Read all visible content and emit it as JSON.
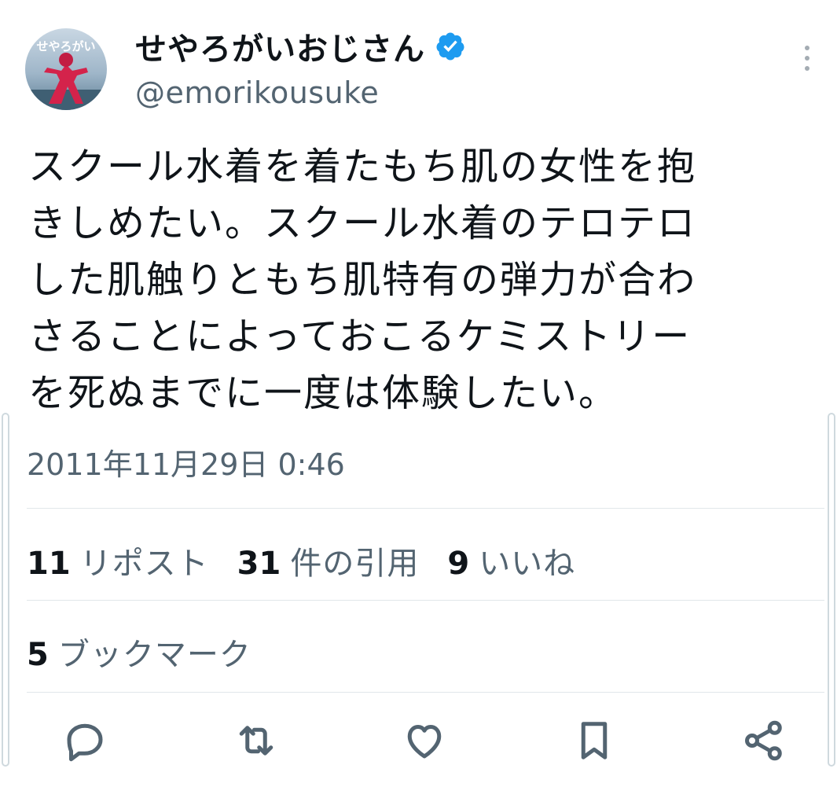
{
  "user": {
    "display_name": "せやろがいおじさん",
    "handle": "@emorikousuke",
    "avatar_caption": "せやろがい",
    "verified": true,
    "verified_color": "#1d9bf0"
  },
  "tweet": {
    "lines": [
      "スクール水着を着たもち肌の女性を抱",
      "きしめたい。スクール水着のテロテロ",
      "した肌触りともち肌特有の弾力が合わ",
      "さることによっておこるケミストリー",
      "を死ぬまでに一度は体験したい。"
    ],
    "timestamp": "2011年11月29日 0:46"
  },
  "stats": {
    "reposts": {
      "count": "11",
      "label": "リポスト"
    },
    "quotes": {
      "count": "31",
      "label": "件の引用"
    },
    "likes": {
      "count": "9",
      "label": "いいね"
    },
    "bookmarks": {
      "count": "5",
      "label": "ブックマーク"
    }
  },
  "actions": [
    "reply-icon",
    "repost-icon",
    "like-icon",
    "bookmark-icon",
    "share-icon"
  ],
  "colors": {
    "text": "#0f1419",
    "secondary": "#536471",
    "divider": "#e1e7ea",
    "icon": "#536471"
  }
}
